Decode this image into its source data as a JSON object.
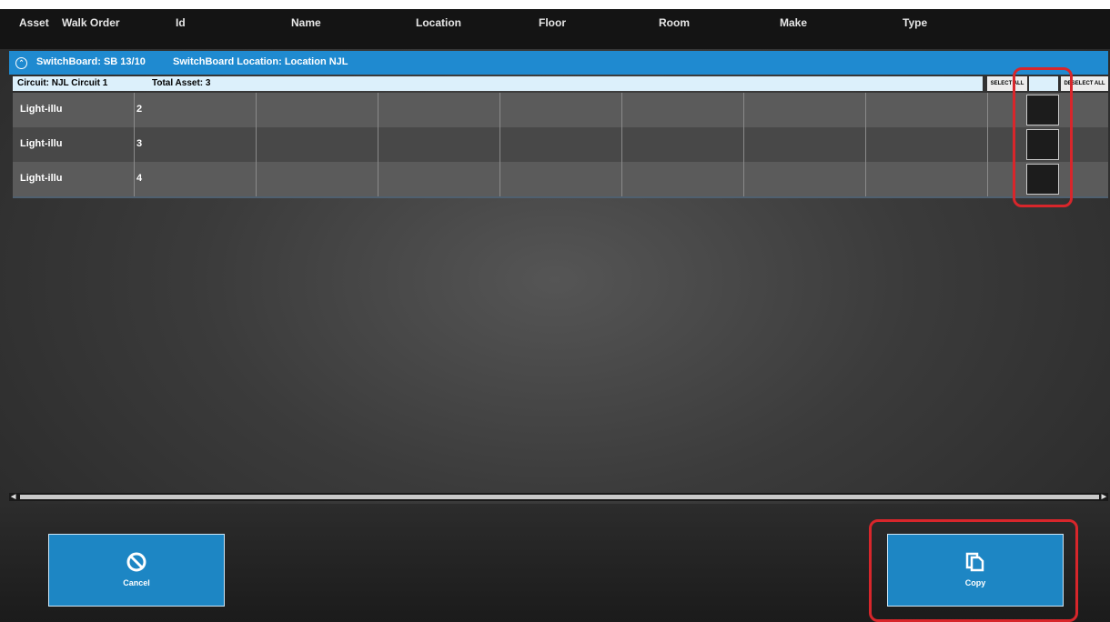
{
  "header": {
    "columns": [
      "Asset",
      "Walk Order",
      "Id",
      "Name",
      "Location",
      "Floor",
      "Room",
      "Make",
      "Type"
    ]
  },
  "switchboard": {
    "label": "SwitchBoard: SB 13/10",
    "location": "SwitchBoard Location: Location NJL"
  },
  "circuit": {
    "label": "Circuit: NJL Circuit 1",
    "total": "Total Asset: 3",
    "select_all": "SELECT ALL",
    "deselect_all": "DESELECT ALL"
  },
  "rows": [
    {
      "asset": "Light-illu",
      "walk_order": "2",
      "checked": false
    },
    {
      "asset": "Light-illu",
      "walk_order": "3",
      "checked": false
    },
    {
      "asset": "Light-illu",
      "walk_order": "4",
      "checked": false
    }
  ],
  "actions": {
    "cancel_label": "Cancel",
    "copy_label": "Copy"
  },
  "icons": {
    "cancel": "ban-icon",
    "copy": "copy-icon",
    "toggle": "collapse-circle-icon"
  },
  "colors": {
    "accent": "#1f8ad0",
    "highlight": "#d8262b",
    "circuit_bg": "#dcf0fb"
  }
}
